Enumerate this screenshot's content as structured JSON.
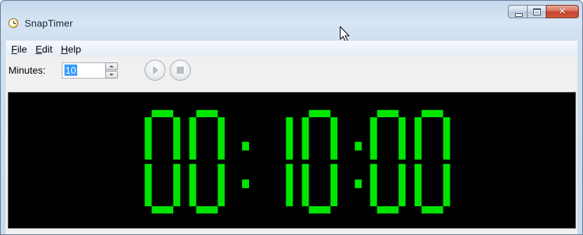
{
  "window": {
    "title": "SnapTimer",
    "caption_buttons": {
      "minimize": "minimize-icon",
      "maximize": "maximize-icon",
      "close": "✕"
    }
  },
  "menu": {
    "items": [
      {
        "label": "File",
        "mnemonic": "F"
      },
      {
        "label": "Edit",
        "mnemonic": "E"
      },
      {
        "label": "Help",
        "mnemonic": "H"
      }
    ]
  },
  "toolbar": {
    "minutes_label": "Minutes:",
    "minutes_value": "10",
    "play_icon": "play-icon",
    "stop_icon": "stop-icon"
  },
  "display": {
    "time": "00:10:00",
    "digit_color": "#00e500",
    "background_color": "#000000"
  },
  "colors": {
    "accent": "#3399ff",
    "close_button": "#c4412a"
  }
}
